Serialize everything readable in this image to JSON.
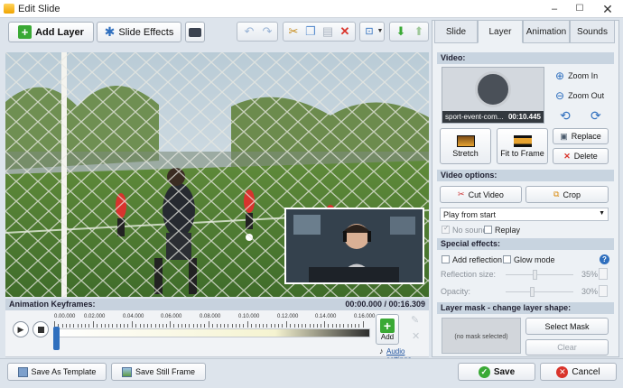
{
  "window": {
    "title": "Edit Slide",
    "min": "–",
    "max": "☐",
    "close": "✕"
  },
  "toolbar": {
    "add_layer": "Add Layer",
    "slide_effects": "Slide Effects"
  },
  "tabs": [
    {
      "label": "Slide"
    },
    {
      "label": "Layer"
    },
    {
      "label": "Animation"
    },
    {
      "label": "Sounds"
    }
  ],
  "video": {
    "section": "Video:",
    "filename": "sport-event-com...",
    "duration": "00:10.445",
    "zoom_in": "Zoom In",
    "zoom_out": "Zoom Out",
    "stretch": "Stretch",
    "fit_to_frame": "Fit to Frame",
    "replace": "Replace",
    "delete": "Delete"
  },
  "video_options": {
    "section": "Video options:",
    "cut_video": "Cut Video",
    "crop": "Crop",
    "play_mode": "Play from start",
    "no_sound": "No sound",
    "replay": "Replay"
  },
  "special_effects": {
    "section": "Special effects:",
    "add_reflection": "Add reflection",
    "glow_mode": "Glow mode",
    "help": "?",
    "reflection_size_label": "Reflection size:",
    "reflection_size_value": "35%",
    "opacity_label": "Opacity:",
    "opacity_value": "30%"
  },
  "layer_mask": {
    "section": "Layer mask - change layer shape:",
    "no_mask": "(no mask selected)",
    "select_mask": "Select Mask",
    "clear": "Clear"
  },
  "keyframes": {
    "title": "Animation Keyframes:",
    "time": "00:00.000 / 00:16.309",
    "ticks": [
      "0.00.000",
      "0.02.000",
      "0.04.000",
      "0.06.000",
      "0.08.000",
      "0.10.000",
      "0.12.000",
      "0.14.000",
      "0.16.000"
    ],
    "add": "Add",
    "audio_settings": "Audio settings"
  },
  "bottom": {
    "save_template": "Save As Template",
    "save_still": "Save Still Frame",
    "save": "Save",
    "cancel": "Cancel"
  },
  "colors": {
    "accent": "#2f6fbe",
    "green": "#3aa935",
    "red": "#d9342b"
  }
}
